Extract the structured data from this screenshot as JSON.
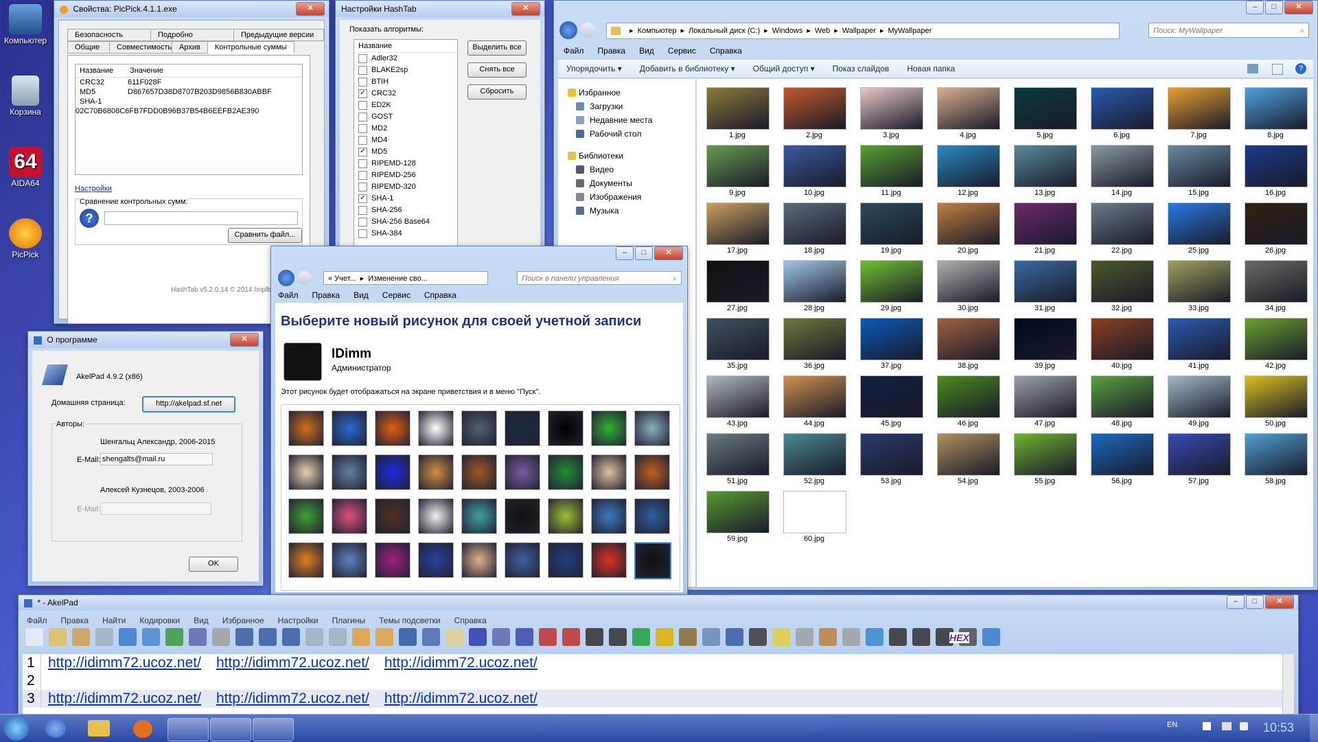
{
  "desktop_icons": [
    {
      "label": "Компьютер"
    },
    {
      "label": "Корзина"
    },
    {
      "label": "AIDA64"
    },
    {
      "label": "PicPick"
    }
  ],
  "props_window": {
    "title": "Свойства: PicPick.4.1.1.exe",
    "tabs_row1": [
      "Безопасность",
      "Подробно",
      "Предыдущие версии"
    ],
    "tabs_row2": [
      "Общие",
      "Совместимость",
      "Архив",
      "Контрольные суммы"
    ],
    "col_name": "Название",
    "col_value": "Значение",
    "rows": [
      {
        "name": "CRC32",
        "value": "611F028F"
      },
      {
        "name": "MD5",
        "value": "D867657D38D8707B203D9856B830ABBF"
      },
      {
        "name": "SHA-1",
        "value": "02C70B6808C6FB7FDD0B96B37B54B6EEFB2AE390"
      }
    ],
    "settings_link": "Настройки",
    "compare_label": "Сравнение контрольных сумм:",
    "compare_button": "Сравнить файл...",
    "footer": "HashTab v5.2.0.14 © 2014 Implbits Software"
  },
  "hashtab_window": {
    "title": "Настройки HashTab",
    "show_label": "Показать алгоритмы:",
    "list_header": "Название",
    "algorithms": [
      {
        "name": "Adler32",
        "checked": false
      },
      {
        "name": "BLAKE2sp",
        "checked": false
      },
      {
        "name": "BTIH",
        "checked": false
      },
      {
        "name": "CRC32",
        "checked": true
      },
      {
        "name": "ED2K",
        "checked": false
      },
      {
        "name": "GOST",
        "checked": false
      },
      {
        "name": "MD2",
        "checked": false
      },
      {
        "name": "MD4",
        "checked": false
      },
      {
        "name": "MD5",
        "checked": true
      },
      {
        "name": "RIPEMD-128",
        "checked": false
      },
      {
        "name": "RIPEMD-256",
        "checked": false
      },
      {
        "name": "RIPEMD-320",
        "checked": false
      },
      {
        "name": "SHA-1",
        "checked": true
      },
      {
        "name": "SHA-256",
        "checked": false
      },
      {
        "name": "SHA-256 Base64",
        "checked": false
      },
      {
        "name": "SHA-384",
        "checked": false
      }
    ],
    "btn_select_all": "Выделить все",
    "btn_clear_all": "Снять все",
    "btn_reset": "Сбросить"
  },
  "explorer": {
    "breadcrumb": [
      "Компьютер",
      "Локальный диск (C:)",
      "Windows",
      "Web",
      "Wallpaper",
      "MyWallpaper"
    ],
    "search_placeholder": "Поиск: MyWallpaper",
    "menu": [
      "Файл",
      "Правка",
      "Вид",
      "Сервис",
      "Справка"
    ],
    "toolbar": [
      "Упорядочить ▾",
      "Добавить в библиотеку ▾",
      "Общий доступ ▾",
      "Показ слайдов",
      "Новая папка"
    ],
    "nav_favorites": "Избранное",
    "nav_fav_items": [
      "Загрузки",
      "Недавние места",
      "Рабочий стол"
    ],
    "nav_libraries": "Библиотеки",
    "nav_lib_items": [
      "Видео",
      "Документы",
      "Изображения",
      "Музыка"
    ],
    "files": [
      "1.jpg",
      "2.jpg",
      "3.jpg",
      "4.jpg",
      "5.jpg",
      "6.jpg",
      "7.jpg",
      "8.jpg",
      "9.jpg",
      "10.jpg",
      "11.jpg",
      "12.jpg",
      "13.jpg",
      "14.jpg",
      "15.jpg",
      "16.jpg",
      "17.jpg",
      "18.jpg",
      "19.jpg",
      "20.jpg",
      "21.jpg",
      "22.jpg",
      "25.jpg",
      "26.jpg",
      "27.jpg",
      "28.jpg",
      "29.jpg",
      "30.jpg",
      "31.jpg",
      "32.jpg",
      "33.jpg",
      "34.jpg",
      "35.jpg",
      "36.jpg",
      "37.jpg",
      "38.jpg",
      "39.jpg",
      "40.jpg",
      "41.jpg",
      "42.jpg",
      "43.jpg",
      "44.jpg",
      "45.jpg",
      "46.jpg",
      "47.jpg",
      "48.jpg",
      "49.jpg",
      "50.jpg",
      "51.jpg",
      "52.jpg",
      "53.jpg",
      "54.jpg",
      "55.jpg",
      "56.jpg",
      "57.jpg",
      "58.jpg",
      "59.jpg",
      "60.jpg"
    ],
    "thumb_colors": [
      "#8a7a3a",
      "#c25a2a",
      "#e8c8c8",
      "#d8b090",
      "#0a3a3a",
      "#2a5ab0",
      "#e8a030",
      "#50a0e0",
      "#6a9a50",
      "#3a5aa0",
      "#58a030",
      "#2a8ac0",
      "#5a8a9a",
      "#8a9aa0",
      "#6a8aa0",
      "#1a3a8a",
      "#c8a060",
      "#5a6a7a",
      "#2a4a5a",
      "#c08040",
      "#6a2a6a",
      "#6a7a8a",
      "#2a7ae0",
      "#302010",
      "#101010",
      "#a0c8e8",
      "#70c030",
      "#b0b0b0",
      "#3a6aa0",
      "#4a5a2a",
      "#a0a060",
      "#6a6a60",
      "#405060",
      "#6a7a3a",
      "#0a5ab8",
      "#a06040",
      "#000820",
      "#8a4020",
      "#2a5ab0",
      "#6aa030",
      "#b0b8c0",
      "#d09050",
      "#102040",
      "#4a8a20",
      "#9aa0a8",
      "#5aa040",
      "#a0b8c8",
      "#d8c020",
      "#6a7a80",
      "#4a8a90",
      "#2a3a6a",
      "#b09060",
      "#70b030",
      "#1a6ac0",
      "#3a4ab0",
      "#50a0d0",
      "#5a9a30"
    ]
  },
  "control_panel": {
    "breadcrumb": [
      "Учет...",
      "Изменение сво..."
    ],
    "search_placeholder": "Поиск в панели управления",
    "menu": [
      "Файл",
      "Правка",
      "Вид",
      "Сервис",
      "Справка"
    ],
    "heading": "Выберите новый рисунок для своей учетной записи",
    "user_name": "IDimm",
    "user_role": "Администратор",
    "note": "Этот рисунок будет отображаться на экране приветствия и в меню \"Пуск\".",
    "avatar_colors": [
      "#d0701a",
      "#2a6ad0",
      "#e06010",
      "#ffffff",
      "#506070",
      "#1a2a40",
      "#000000",
      "#30b030",
      "#8ab0c0",
      "#e8d0b0",
      "#6080a0",
      "#1a2ae0",
      "#d09040",
      "#a05a20",
      "#7a5aa0",
      "#209030",
      "#e0c0a0",
      "#c06020",
      "#40a030",
      "#e05080",
      "#503020",
      "#f0f0f0",
      "#40a0a0",
      "#101010",
      "#a0c030",
      "#3a7ac0",
      "#2a60a0",
      "#e08020",
      "#6080c0",
      "#a02080",
      "#2a40a0",
      "#e0b090",
      "#4060a0",
      "#204080",
      "#e03020",
      "#101010"
    ]
  },
  "about_dialog": {
    "title": "О программе",
    "app": "AkelPad 4.9.2 (x86)",
    "homepage_label": "Домашняя страница:",
    "homepage": "http://akelpad.sf.net",
    "authors_label": "Авторы:",
    "author1": "Шенгальц Александр, 2006-2015",
    "email_label": "E-Mail:",
    "email1": "shengalts@mail.ru",
    "author2": "Алексей Кузнецов, 2003-2006",
    "email_label2": "E-Mail:",
    "ok": "OK"
  },
  "akelpad": {
    "title": "* - AkelPad",
    "menu": [
      "Файл",
      "Правка",
      "Найти",
      "Кодировки",
      "Вид",
      "Избранное",
      "Настройки",
      "Плагины",
      "Темы подсветки",
      "Справка"
    ],
    "lines": [
      {
        "num": "1",
        "text": [
          "http://idimm72.ucoz.net/",
          "http://idimm72.ucoz.net/",
          "http://idimm72.ucoz.net/"
        ]
      },
      {
        "num": "2",
        "text": []
      },
      {
        "num": "3",
        "text": [
          "http://idimm72.ucoz.net/",
          "http://idimm72.ucoz.net/",
          "http://idimm72.ucoz.net/"
        ]
      }
    ],
    "hex_label": "HEX"
  },
  "taskbar": {
    "lang": "EN",
    "time": "10:53"
  }
}
